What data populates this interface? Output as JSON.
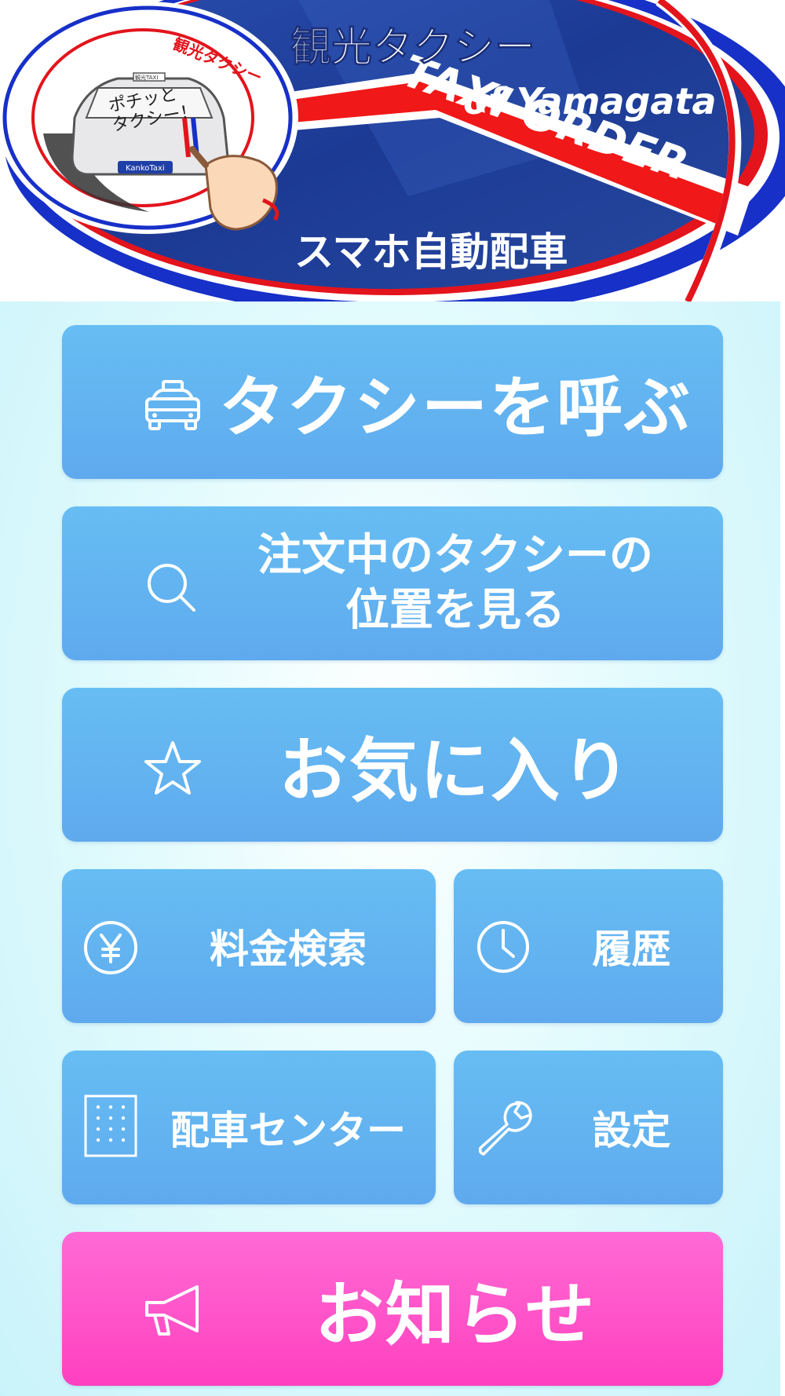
{
  "banner": {
    "title_jp": "観光タクシー",
    "subtitle_en": "of Yamagata",
    "stripe_text": "TAXI ORDER",
    "tagline_jp": "スマホ自動配車",
    "logo": {
      "arc_text": "観光タクシー",
      "bubble_text": "ポチッと\nタクシー！",
      "plate_text": "KankoTaxi",
      "roof_sign_text": "観光TAXI"
    }
  },
  "menu": {
    "call_taxi": {
      "label": "タクシーを呼ぶ",
      "icon": "taxi-icon"
    },
    "track_taxi": {
      "label": "注文中のタクシーの\n位置を見る",
      "icon": "search-icon"
    },
    "favorites": {
      "label": "お気に入り",
      "icon": "star-icon"
    },
    "fare_search": {
      "label": "料金検索",
      "icon": "yen-icon"
    },
    "history": {
      "label": "履歴",
      "icon": "clock-icon"
    },
    "dispatch_center": {
      "label": "配車センター",
      "icon": "building-icon"
    },
    "settings": {
      "label": "設定",
      "icon": "wrench-icon"
    },
    "news": {
      "label": "お知らせ",
      "icon": "megaphone-icon"
    }
  },
  "colors": {
    "button_blue": "#63b4f0",
    "button_pink": "#ff4fc6",
    "banner_navy": "#1e3c8c",
    "banner_red": "#e8141e",
    "background": "#d2f5fb"
  }
}
